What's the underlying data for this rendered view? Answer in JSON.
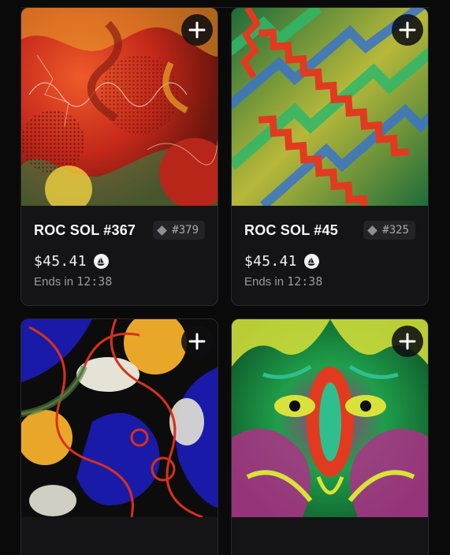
{
  "cards": [
    {
      "name": "ROC SOL #367",
      "rank": "#379",
      "price": "$45.41",
      "ends_label": "Ends in",
      "ends_time": "12:38",
      "add_icon": "plus-icon",
      "chain_icon": "sailboat-coin-icon",
      "colors": [
        "#d8301c",
        "#e9a72a",
        "#8a1f12",
        "#2c8c49",
        "#f0d240"
      ]
    },
    {
      "name": "ROC SOL #45",
      "rank": "#325",
      "price": "$45.41",
      "ends_label": "Ends in",
      "ends_time": "12:38",
      "add_icon": "plus-icon",
      "chain_icon": "sailboat-coin-icon",
      "colors": [
        "#e23a1f",
        "#1d6b3a",
        "#b7b83a",
        "#2fb86a",
        "#3a74c8"
      ]
    },
    {
      "name": "",
      "add_icon": "plus-icon",
      "colors": [
        "#1a1aa8",
        "#e9a72a",
        "#0c0c0c",
        "#e5e2d6",
        "#d8301c"
      ]
    },
    {
      "name": "",
      "add_icon": "plus-icon",
      "colors": [
        "#d8e23a",
        "#2fbf8f",
        "#b72a8c",
        "#e23a1f",
        "#1f9e4a"
      ]
    }
  ]
}
